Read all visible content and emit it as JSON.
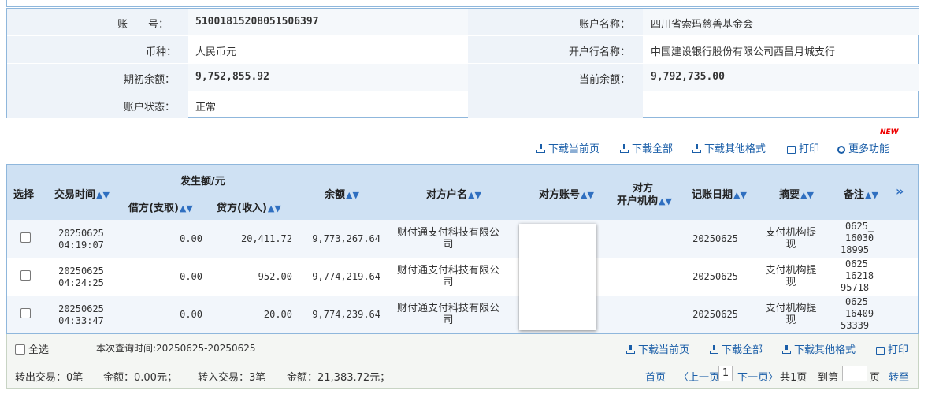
{
  "account_info": {
    "account_no_label": "账　　号：",
    "account_no": "51001815208051506397",
    "account_name_label": "账户名称：",
    "account_name": "四川省索玛慈善基金会",
    "currency_label": "币种：",
    "currency": "人民币元",
    "bank_label": "开户行名称：",
    "bank": "中国建设银行股份有限公司西昌月城支行",
    "opening_balance_label": "期初余额：",
    "opening_balance": "9,752,855.92",
    "current_balance_label": "当前余额：",
    "current_balance": "9,792,735.00",
    "status_label": "账户状态：",
    "status": "正常"
  },
  "toolbar": {
    "new_badge": "NEW",
    "download_current": "下载当前页",
    "download_all": "下载全部",
    "download_other": "下载其他格式",
    "print": "打印",
    "more": "更多功能"
  },
  "table": {
    "headers": {
      "select": "选择",
      "time": "交易时间",
      "amount_group": "发生额/元",
      "debit": "借方(支取)",
      "credit": "贷方(收入)",
      "balance": "余额",
      "counterparty_name": "对方户名",
      "counterparty_account": "对方账号",
      "counterparty_bank_1": "对方",
      "counterparty_bank_2": "开户机构",
      "posting_date": "记账日期",
      "summary": "摘要",
      "remark": "备注",
      "sort_arrow": "▲▼",
      "expand": "»"
    },
    "rows": [
      {
        "date": "20250625",
        "time": "04:19:07",
        "debit": "0.00",
        "credit": "20,411.72",
        "balance": "9,773,267.64",
        "name1": "财付通支付科技有限公",
        "name2": "司",
        "posting": "20250625",
        "sum1": "支付机构提",
        "sum2": "现",
        "rm1": "0625_",
        "rm2": "16030",
        "rm3": "18995"
      },
      {
        "date": "20250625",
        "time": "04:24:25",
        "debit": "0.00",
        "credit": "952.00",
        "balance": "9,774,219.64",
        "name1": "财付通支付科技有限公",
        "name2": "司",
        "posting": "20250625",
        "sum1": "支付机构提",
        "sum2": "现",
        "rm1": "0625_",
        "rm2": "16218",
        "rm3": "95718"
      },
      {
        "date": "20250625",
        "time": "04:33:47",
        "debit": "0.00",
        "credit": "20.00",
        "balance": "9,774,239.64",
        "name1": "财付通支付科技有限公",
        "name2": "司",
        "posting": "20250625",
        "sum1": "支付机构提",
        "sum2": "现",
        "rm1": "0625_",
        "rm2": "16409",
        "rm3": "53339"
      }
    ]
  },
  "footer": {
    "select_all": "全选",
    "query_time": "本次查询时间:20250625-20250625",
    "download_current": "下载当前页",
    "download_all": "下载全部",
    "download_other": "下载其他格式",
    "print": "打印",
    "out_tx": "转出交易：0笔",
    "out_amt": "金额：0.00元；",
    "in_tx": "转入交易：3笔",
    "in_amt": "金额：21,383.72元；",
    "first": "首页",
    "prev": "〈上一页",
    "page": "1",
    "next": "下一页〉",
    "total": "共1页",
    "goto": "到第",
    "page_unit": "页",
    "jump": "转至"
  }
}
